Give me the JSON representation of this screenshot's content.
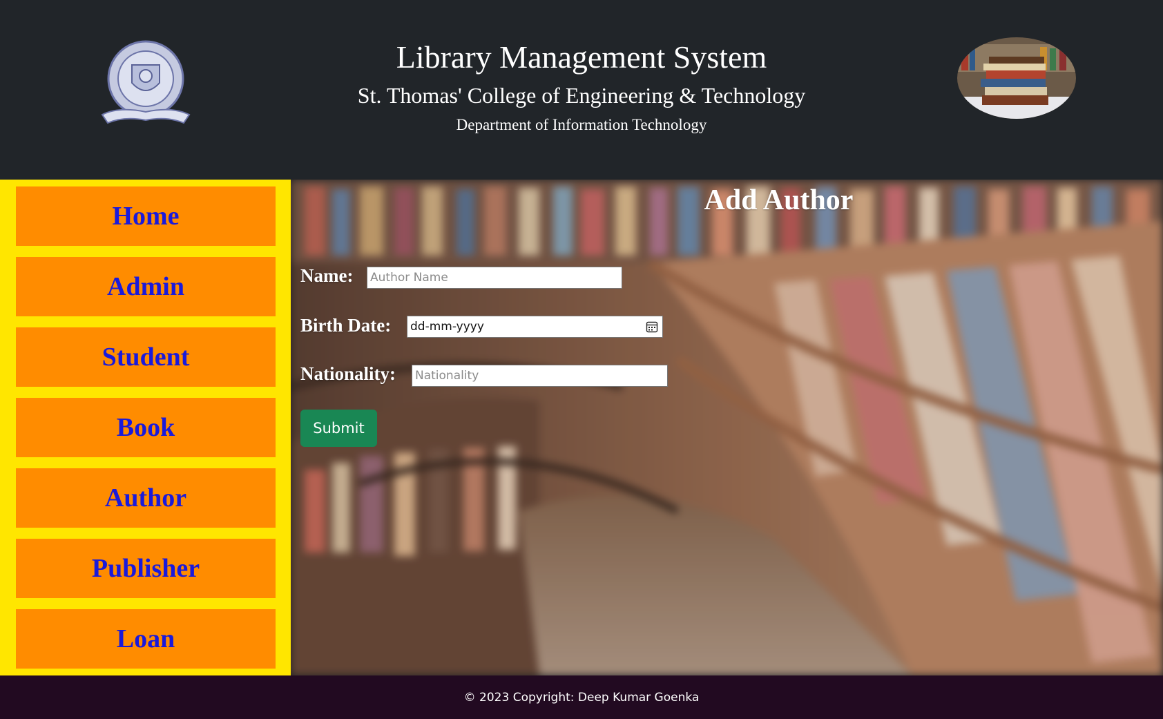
{
  "header": {
    "title": "Library Management System",
    "college": "St. Thomas' College of Engineering & Technology",
    "department": "Department of Information Technology",
    "logo_icon": "college-crest-logo",
    "books_icon": "book-stack-image"
  },
  "sidebar": {
    "items": [
      {
        "label": "Home"
      },
      {
        "label": "Admin"
      },
      {
        "label": "Student"
      },
      {
        "label": "Book"
      },
      {
        "label": "Author"
      },
      {
        "label": "Publisher"
      },
      {
        "label": "Loan"
      }
    ],
    "background_color": "#ffe600",
    "button_color": "#ff8c00",
    "text_color": "#1a1adb"
  },
  "form": {
    "title": "Add Author",
    "name_label": "Name:",
    "name_placeholder": "Author Name",
    "birth_label": "Birth Date:",
    "birth_value": "dd-mm-yyyy",
    "nationality_label": "Nationality:",
    "nationality_placeholder": "Nationality",
    "submit_label": "Submit",
    "submit_color": "#198754"
  },
  "footer": {
    "text": "© 2023 Copyright: Deep Kumar Goenka"
  }
}
